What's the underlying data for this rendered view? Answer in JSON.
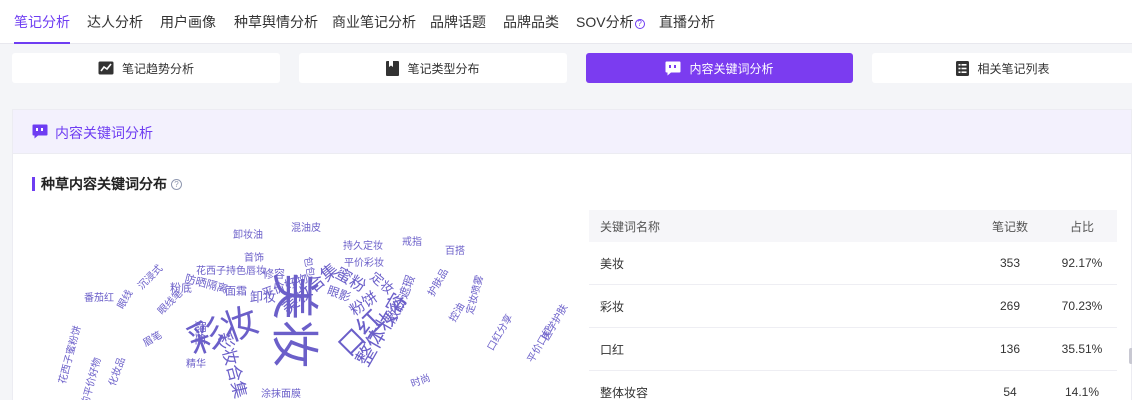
{
  "nav_tabs": [
    {
      "label": "笔记分析",
      "active": true
    },
    {
      "label": "达人分析"
    },
    {
      "label": "用户画像"
    },
    {
      "label": "种草舆情分析"
    },
    {
      "label": "商业笔记分析"
    },
    {
      "label": "品牌话题"
    },
    {
      "label": "品牌品类"
    },
    {
      "label": "SOV分析",
      "help_mark": "?"
    },
    {
      "label": "直播分析"
    }
  ],
  "sub_tabs": [
    {
      "label": "笔记趋势分析",
      "icon": "trend-chart-icon"
    },
    {
      "label": "笔记类型分布",
      "icon": "bookmark-icon"
    },
    {
      "label": "内容关键词分析",
      "icon": "chat-bubble-icon",
      "active": true
    },
    {
      "label": "相关笔记列表",
      "icon": "list-icon"
    }
  ],
  "panel": {
    "title": "内容关键词分析",
    "icon": "chat-bubble-icon"
  },
  "section": {
    "title": "种草内容关键词分布",
    "help_mark": "?"
  },
  "colors": {
    "accent": "#6e3df2",
    "active_tab_bg": "#7b3cf0",
    "panel_header_bg": "#f3f1fd",
    "wordcloud": "#6b5fc9"
  },
  "word_cloud": {
    "words": [
      "美妆",
      "彩妆",
      "口红",
      "整体妆容",
      "彩妆合集",
      "美妆合集",
      "蜜粉",
      "粉饼",
      "散粉",
      "定妆",
      "卸妆",
      "平价好物",
      "眼影",
      "腮红",
      "遮瑕",
      "粉底",
      "防晒隔离",
      "面霜",
      "修容",
      "包包",
      "首饰",
      "卸妆油",
      "混油皮",
      "持久定妆",
      "平价彩妆",
      "戒指",
      "百搭",
      "护肤品",
      "花西子持色唇妆",
      "番茄红",
      "控油",
      "眼线笔",
      "精华",
      "时尚",
      "口红分享",
      "平价口红",
      "医学护肤",
      "花西子蜜粉饼",
      "我的平价好物",
      "沉浸式",
      "眉笔",
      "定妆喷雾",
      "眼线",
      "涂抹面膜",
      "化妆品"
    ]
  },
  "table": {
    "columns": [
      "关键词名称",
      "笔记数",
      "占比"
    ],
    "rows": [
      {
        "name": "美妆",
        "count": "353",
        "ratio": "92.17%"
      },
      {
        "name": "彩妆",
        "count": "269",
        "ratio": "70.23%"
      },
      {
        "name": "口红",
        "count": "136",
        "ratio": "35.51%"
      },
      {
        "name": "整体妆容",
        "count": "54",
        "ratio": "14.1%"
      }
    ]
  }
}
